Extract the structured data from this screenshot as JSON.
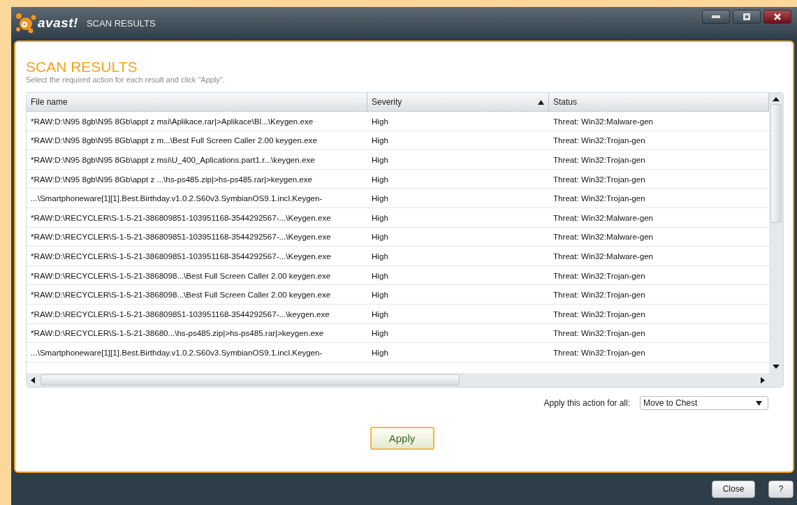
{
  "window": {
    "logo": "avast!",
    "title": "SCAN RESULTS"
  },
  "heading": "SCAN RESULTS",
  "subtitle": "Select the required action for each result and click \"Apply\".",
  "table": {
    "columns": [
      {
        "label": "File name",
        "sorted": false
      },
      {
        "label": "Severity",
        "sorted": true
      },
      {
        "label": "Status",
        "sorted": false
      }
    ],
    "rows": [
      {
        "file": "*RAW:D:\\N95 8gb\\N95 8Gb\\appt z msi\\Aplikace.rar|>Aplikace\\Bl...\\Keygen.exe",
        "severity": "High",
        "status": "Threat: Win32:Malware-gen"
      },
      {
        "file": "*RAW:D:\\N95 8gb\\N95 8Gb\\appt z m...\\Best Full Screen Caller 2.00 keygen.exe",
        "severity": "High",
        "status": "Threat: Win32:Trojan-gen"
      },
      {
        "file": "*RAW:D:\\N95 8gb\\N95 8Gb\\appt z msi\\U_400_Aplications.part1.r...\\keygen.exe",
        "severity": "High",
        "status": "Threat: Win32:Trojan-gen"
      },
      {
        "file": "*RAW:D:\\N95 8gb\\N95 8Gb\\appt z ...\\hs-ps485.zip|>hs-ps485.rar|>keygen.exe",
        "severity": "High",
        "status": "Threat: Win32:Trojan-gen"
      },
      {
        "file": "...\\Smartphoneware[1][1].Best.Birthday.v1.0.2.S60v3.SymbianOS9.1.incl.Keygen-",
        "severity": "High",
        "status": "Threat: Win32:Trojan-gen"
      },
      {
        "file": "*RAW:D:\\RECYCLER\\S-1-5-21-386809851-103951168-3544292567-...\\Keygen.exe",
        "severity": "High",
        "status": "Threat: Win32:Malware-gen"
      },
      {
        "file": "*RAW:D:\\RECYCLER\\S-1-5-21-386809851-103951168-3544292567-...\\Keygen.exe",
        "severity": "High",
        "status": "Threat: Win32:Malware-gen"
      },
      {
        "file": "*RAW:D:\\RECYCLER\\S-1-5-21-386809851-103951168-3544292567-...\\Keygen.exe",
        "severity": "High",
        "status": "Threat: Win32:Malware-gen"
      },
      {
        "file": "*RAW:D:\\RECYCLER\\S-1-5-21-3868098...\\Best Full Screen Caller 2.00 keygen.exe",
        "severity": "High",
        "status": "Threat: Win32:Trojan-gen"
      },
      {
        "file": "*RAW:D:\\RECYCLER\\S-1-5-21-3868098...\\Best Full Screen Caller 2.00 keygen.exe",
        "severity": "High",
        "status": "Threat: Win32:Trojan-gen"
      },
      {
        "file": "*RAW:D:\\RECYCLER\\S-1-5-21-386809851-103951168-3544292567-...\\keygen.exe",
        "severity": "High",
        "status": "Threat: Win32:Trojan-gen"
      },
      {
        "file": "*RAW:D:\\RECYCLER\\S-1-5-21-38680...\\hs-ps485.zip|>hs-ps485.rar|>keygen.exe",
        "severity": "High",
        "status": "Threat: Win32:Trojan-gen"
      },
      {
        "file": "...\\Smartphoneware[1][1].Best.Birthday.v1.0.2.S60v3.SymbianOS9.1.incl.Keygen-",
        "severity": "High",
        "status": "Threat: Win32:Trojan-gen"
      }
    ]
  },
  "action": {
    "label": "Apply this action for all:",
    "value": "Move to Chest"
  },
  "apply_button": "Apply",
  "footer_buttons": [
    "Close",
    "?"
  ]
}
